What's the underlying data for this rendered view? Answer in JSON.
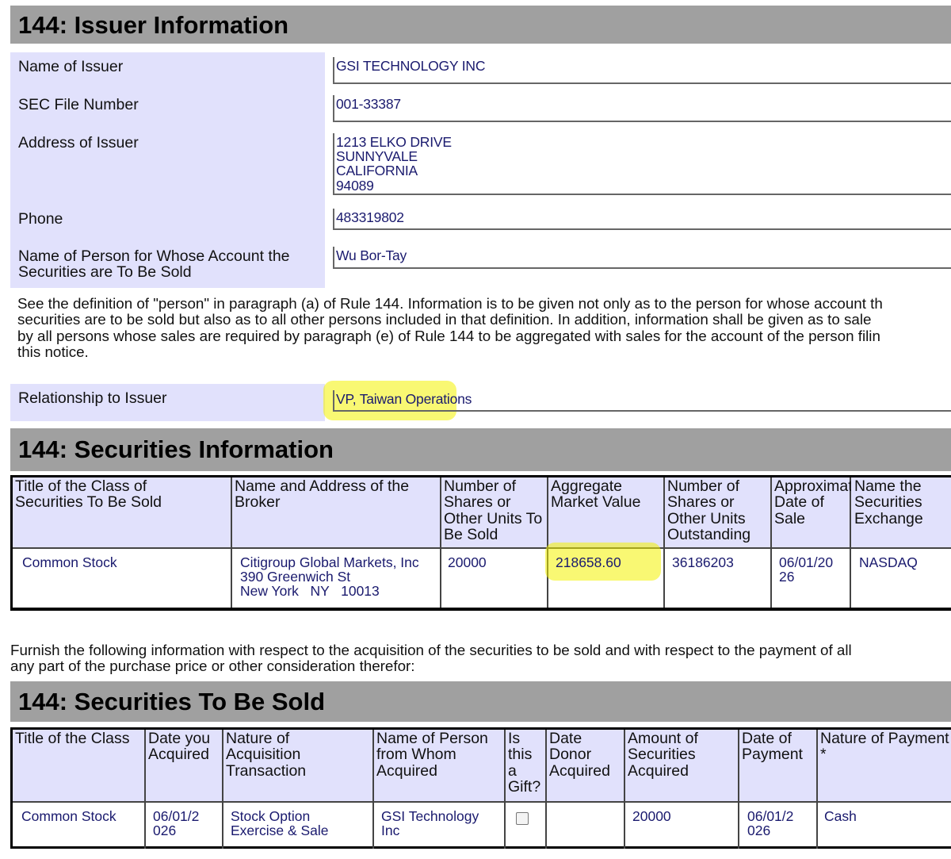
{
  "issuer_section": {
    "title": "144: Issuer Information",
    "fields": [
      {
        "label": "Name of Issuer",
        "value": "GSI TECHNOLOGY INC"
      },
      {
        "label": "SEC File Number",
        "value": "001-33387"
      },
      {
        "label": "Address of Issuer",
        "value": "1213 ELKO DRIVE\nSUNNYVALE\nCALIFORNIA\n94089"
      },
      {
        "label": "Phone",
        "value": "483319802"
      },
      {
        "label": "Name of Person for Whose Account the\nSecurities are To Be Sold",
        "value": "Wu Bor-Tay"
      }
    ],
    "definition_note": "See the definition of \"person\" in paragraph (a) of Rule 144. Information is to be given not only as to the person for whose account th\nsecurities are to be sold but also as to all other persons included in that definition. In addition, information shall be given as to sale\nby all persons whose sales are required by paragraph (e) of Rule 144 to be aggregated with sales for the account of the person filin\nthis notice.",
    "relationship_label": "Relationship to Issuer",
    "relationship_value": "VP, Taiwan Operations"
  },
  "securities_info": {
    "title": "144: Securities Information",
    "headers": [
      "Title of the Class of\nSecurities To Be Sold",
      "Name and Address of the\nBroker",
      "Number of\nShares or\nOther Units To\nBe Sold",
      "Aggregate\nMarket Value",
      "Number of\nShares or\nOther Units\nOutstanding",
      "Approximate\nDate of\nSale",
      "Name the\nSecurities\nExchange"
    ],
    "row": [
      "Common Stock",
      "Citigroup Global Markets, Inc\n390 Greenwich St\nNew York   NY   10013",
      "20000",
      "218658.60",
      "36186203",
      "06/01/20\n26",
      "NASDAQ"
    ]
  },
  "acquisition_note": "Furnish the following information with respect to the acquisition of the securities to be sold and with respect to the payment of all\nany part of the purchase price or other consideration therefor:",
  "securities_to_be_sold": {
    "title": "144: Securities To Be Sold",
    "headers": [
      "Title of the Class",
      "Date you\nAcquired",
      "Nature of\nAcquisition\nTransaction",
      "Name of Person\nfrom Whom\nAcquired",
      "Is\nthis\na\nGift?",
      "Date\nDonor\nAcquired",
      "Amount of\nSecurities\nAcquired",
      "Date of\nPayment",
      "Nature of Payment\n*"
    ],
    "row": [
      "Common Stock",
      "06/01/2\n026",
      "Stock Option\nExercise & Sale",
      "GSI Technology\nInc",
      "",
      "",
      "20000",
      "06/01/2\n026",
      "Cash"
    ]
  },
  "colors": {
    "header_bg": "#a0a0a0",
    "label_bg": "#e1e1fc",
    "value_text": "#1a1a6e",
    "highlight": "#f4f200"
  }
}
